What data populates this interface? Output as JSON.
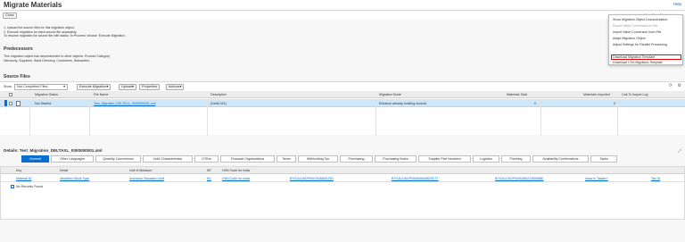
{
  "app": {
    "title": "Migrate Materials",
    "help_label": "Help",
    "you_can_also": "You Can Also ▾"
  },
  "toolbar": {
    "close_label": "Close"
  },
  "intro": {
    "lines": [
      "1. Upload the source files for this migration object.",
      "2. Execute migration for each source file separately.",
      "To resume migration for source file with status 'In Process' choose 'Execute Migration'."
    ]
  },
  "predecessors": {
    "title": "Predecessors",
    "lines": [
      "This migration object has dependencies to other objects: Product Category",
      "Hierarchy, Suppliers, Bank Directory, Customers, Warranties."
    ]
  },
  "menu": {
    "items": [
      "Show Migration Object Documentation",
      "Export Value Conversion to File",
      "Import Value Conversion from File",
      "Adapt Migration Object",
      "Adjust Settings for Parallel Processing",
      "Download Migration Template",
      "Download CSV-Migration-Template"
    ],
    "disabled_index": 1,
    "highlighted_index": 5
  },
  "source_files": {
    "title": "Source Files",
    "show_label": "Show",
    "filter_value": "Not Completed Files",
    "buttons": [
      "Execute Migration▾",
      "Upload▾",
      "Properties",
      "Actions▾"
    ],
    "columns": [
      "Migration Status",
      "File Name",
      "Description",
      "Migration Mode",
      "Materials Total",
      "Materials Imported",
      "Link To Import Log"
    ],
    "rows": [
      {
        "status": "Not Started",
        "file": "Test_Migration_DELTAXL_0000000001.xml",
        "description": "(Delta 001)",
        "mode": "Enhance already existing records",
        "total": "0",
        "imported": "0",
        "log": ""
      }
    ]
  },
  "details": {
    "title": "Details: Test_Migration_DELTAXL_0000000001.xml",
    "tabs": [
      "General",
      "Other Languages",
      "Quantity Conversions",
      "UoM Characteristics",
      "GTINs",
      "Financial Organizations",
      "Taxes",
      "Withholding Tax",
      "Purchasing",
      "Purchasing Notes",
      "Supplier Part Numbers",
      "Logistics",
      "Planning",
      "Availability Confirmations",
      "Sales"
    ],
    "active_tab": 0,
    "columns": [
      "Key",
      "Detail",
      "Unit of Measure",
      "KE",
      "HSN Code for India"
    ],
    "row": [
      "Material ID",
      "Identified Stock Type",
      "Inventory Valuation UoM",
      "KE",
      "HSN Code for India",
      "BYGA1O6OP000763680A75D",
      "BYGA1O6OP000846849625C77",
      "BYGA1O6OP000636022365988E",
      "show in Tasker?",
      "Tax ID"
    ],
    "empty_text": "No Records Found"
  }
}
